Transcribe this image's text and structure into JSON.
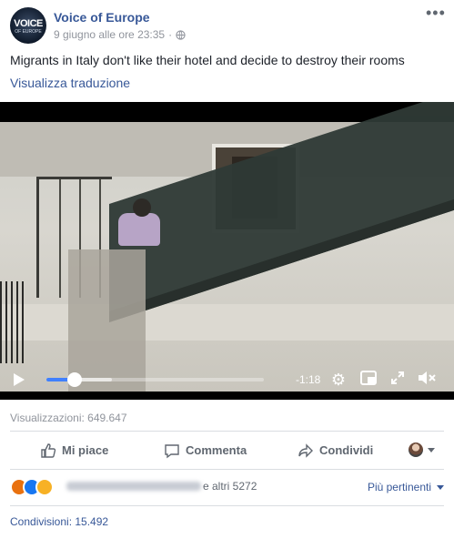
{
  "post": {
    "page_name": "Voice of Europe",
    "avatar_text": "VOICE",
    "avatar_subtext": "OF EUROPE",
    "timestamp": "9 giugno alle ore 23:35",
    "separator": "·",
    "privacy_icon": "globe-icon",
    "more_icon": "more-options-icon",
    "caption": "Migrants in Italy don't like their hotel and decide to destroy their rooms",
    "translate_link": "Visualizza traduzione"
  },
  "video": {
    "current_time": "-1:18",
    "progress": 0.13,
    "buffered": 0.3,
    "icons": [
      "play-icon",
      "settings-gear-icon",
      "picture-in-picture-icon",
      "fullscreen-icon",
      "volume-muted-icon"
    ]
  },
  "stats": {
    "views": "Visualizzazioni: 649.647",
    "shares": "Condivisioni: 15.492"
  },
  "actions": {
    "like": "Mi piace",
    "comment": "Commenta",
    "share": "Condividi"
  },
  "reactions": {
    "others": "e altri 5272",
    "sort_label": "Più pertinenti",
    "icons": [
      "angry-reaction-icon",
      "like-reaction-icon",
      "wow-reaction-icon"
    ],
    "colors": {
      "angry": "#e9710f",
      "like": "#1877f2",
      "wow": "#f7b125"
    }
  },
  "colors": {
    "link": "#385898",
    "secondary_text": "#90949c",
    "progress": "#4080ff"
  }
}
